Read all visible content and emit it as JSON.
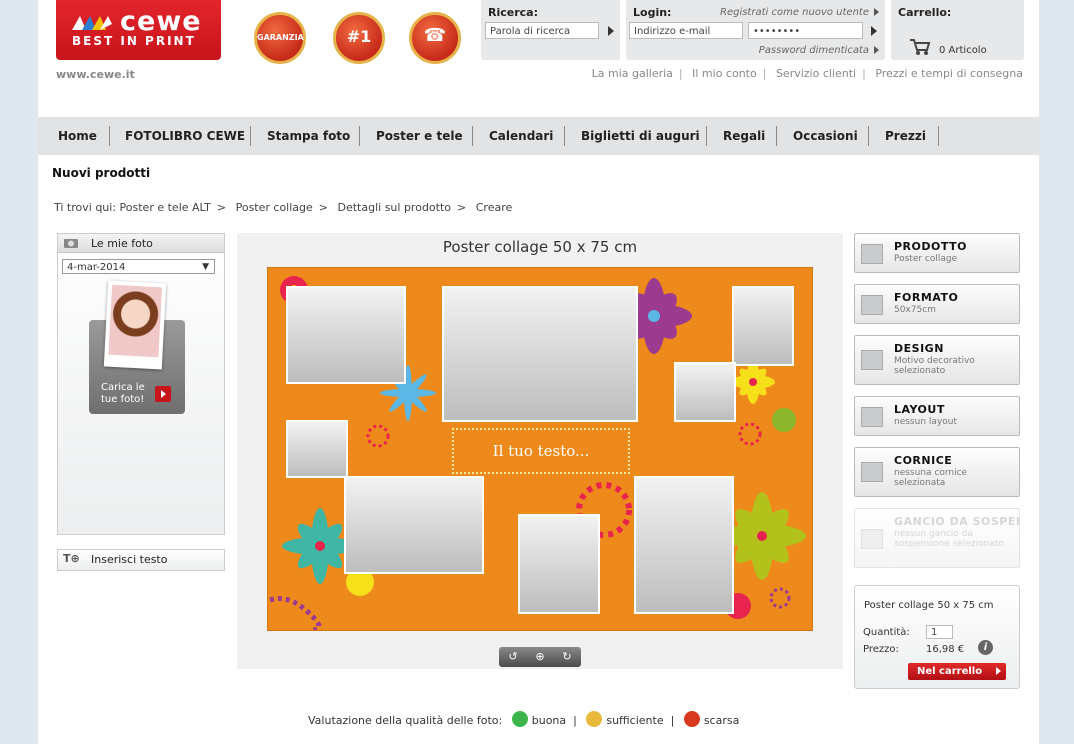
{
  "header": {
    "logo_brand": "cewe",
    "logo_tag": "BEST IN PRINT",
    "url": "www.cewe.it",
    "seals": [
      "GARANZIA",
      "#1",
      "☎"
    ],
    "search": {
      "title": "Ricerca:",
      "placeholder": "Parola di ricerca"
    },
    "login": {
      "title": "Login:",
      "register_link": "Registrati come nuovo utente",
      "email_placeholder": "Indirizzo e-mail",
      "password_value": "••••••••",
      "forgot_link": "Password dimenticata"
    },
    "cart": {
      "title": "Carrello:",
      "count": "0 Articolo"
    },
    "links": [
      "La mia galleria",
      "Il mio conto",
      "Servizio clienti",
      "Prezzi e tempi di consegna"
    ]
  },
  "nav": [
    "Home",
    "FOTOLIBRO CEWE",
    "Stampa foto",
    "Poster e tele",
    "Calendari",
    "Biglietti di auguri",
    "Regali",
    "Occasioni",
    "Prezzi"
  ],
  "page_title": "Nuovi prodotti",
  "breadcrumb": {
    "label": "Ti trovi qui:",
    "items": [
      "Poster e tele ALT",
      "Poster collage",
      "Dettagli sul prodotto",
      "Creare"
    ]
  },
  "left_panel": {
    "title": "Le mie foto",
    "date": "4-mar-2014",
    "upload_label_1": "Carica le",
    "upload_label_2": "tue foto!",
    "insert_text": "Inserisci testo"
  },
  "canvas": {
    "title": "Poster collage 50 x 75 cm",
    "text_placeholder": "Il tuo testo..."
  },
  "rating": {
    "label": "Valutazione della qualità delle foto:",
    "good": "buona",
    "ok": "sufficiente",
    "bad": "scarsa"
  },
  "options": [
    {
      "title": "PRODOTTO",
      "sub": "Poster collage"
    },
    {
      "title": "FORMATO",
      "sub": "50x75cm"
    },
    {
      "title": "DESIGN",
      "sub": "Motivo decorativo selezionato"
    },
    {
      "title": "LAYOUT",
      "sub": "nessun layout"
    },
    {
      "title": "CORNICE",
      "sub": "nessuna cornice selezionata"
    },
    {
      "title": "GANCIO DA SOSPENS",
      "sub": "nessun gancio da sospensione selezionato"
    }
  ],
  "cart_box": {
    "product": "Poster collage 50 x 75 cm",
    "qty_label": "Quantità:",
    "qty_value": "1",
    "price_label": "Prezzo:",
    "price_value": "16,98 €",
    "button": "Nel carrello"
  }
}
